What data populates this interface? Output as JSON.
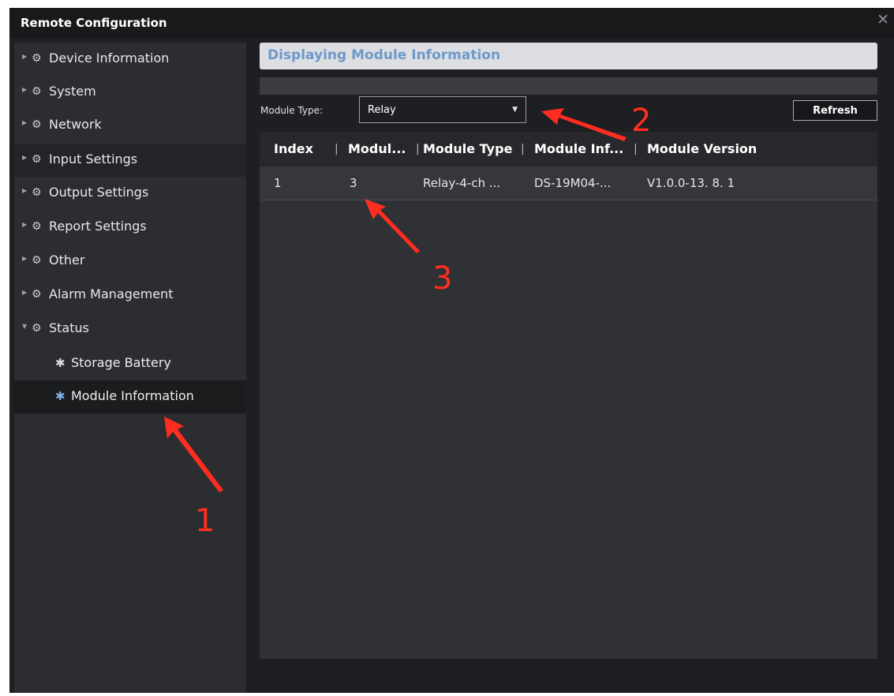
{
  "window": {
    "title": "Remote Configuration",
    "close_glyph": "✕"
  },
  "sidebar": {
    "items": [
      {
        "label": "Device Information",
        "icon": "gear-icon",
        "expanded": false
      },
      {
        "label": "System",
        "icon": "gear-icon",
        "expanded": false
      },
      {
        "label": "Network",
        "icon": "gear-icon",
        "expanded": false
      },
      {
        "label": "Input Settings",
        "icon": "gear-icon",
        "expanded": false
      },
      {
        "label": "Output Settings",
        "icon": "gear-icon",
        "expanded": false
      },
      {
        "label": "Report Settings",
        "icon": "gear-icon",
        "expanded": false
      },
      {
        "label": "Other",
        "icon": "gear-icon",
        "expanded": false
      },
      {
        "label": "Alarm Management",
        "icon": "gear-icon",
        "expanded": false
      },
      {
        "label": "Status",
        "icon": "gear-icon",
        "expanded": true
      }
    ],
    "subitems": [
      {
        "label": "Storage Battery",
        "icon": "gear-icon",
        "selected": false
      },
      {
        "label": "Module Information",
        "icon": "gear-icon",
        "selected": true
      }
    ]
  },
  "main": {
    "header": "Displaying Module Information",
    "module_type_label": "Module Type:",
    "module_type_value": "Relay",
    "refresh_label": "Refresh",
    "table": {
      "columns": [
        "Index",
        "Modul...",
        "Module Type",
        "Module Inf...",
        "Module Version"
      ],
      "rows": [
        [
          "1",
          "3",
          "Relay-4-ch ...",
          "DS-19M04-...",
          "V1.0.0-13. 8. 1"
        ]
      ]
    }
  },
  "annotations": {
    "one": "1",
    "two": "2",
    "three": "3",
    "color": "#ff2d1f"
  },
  "colors": {
    "header_text": "#6e99c8",
    "selected_icon": "#7fb2e6"
  }
}
